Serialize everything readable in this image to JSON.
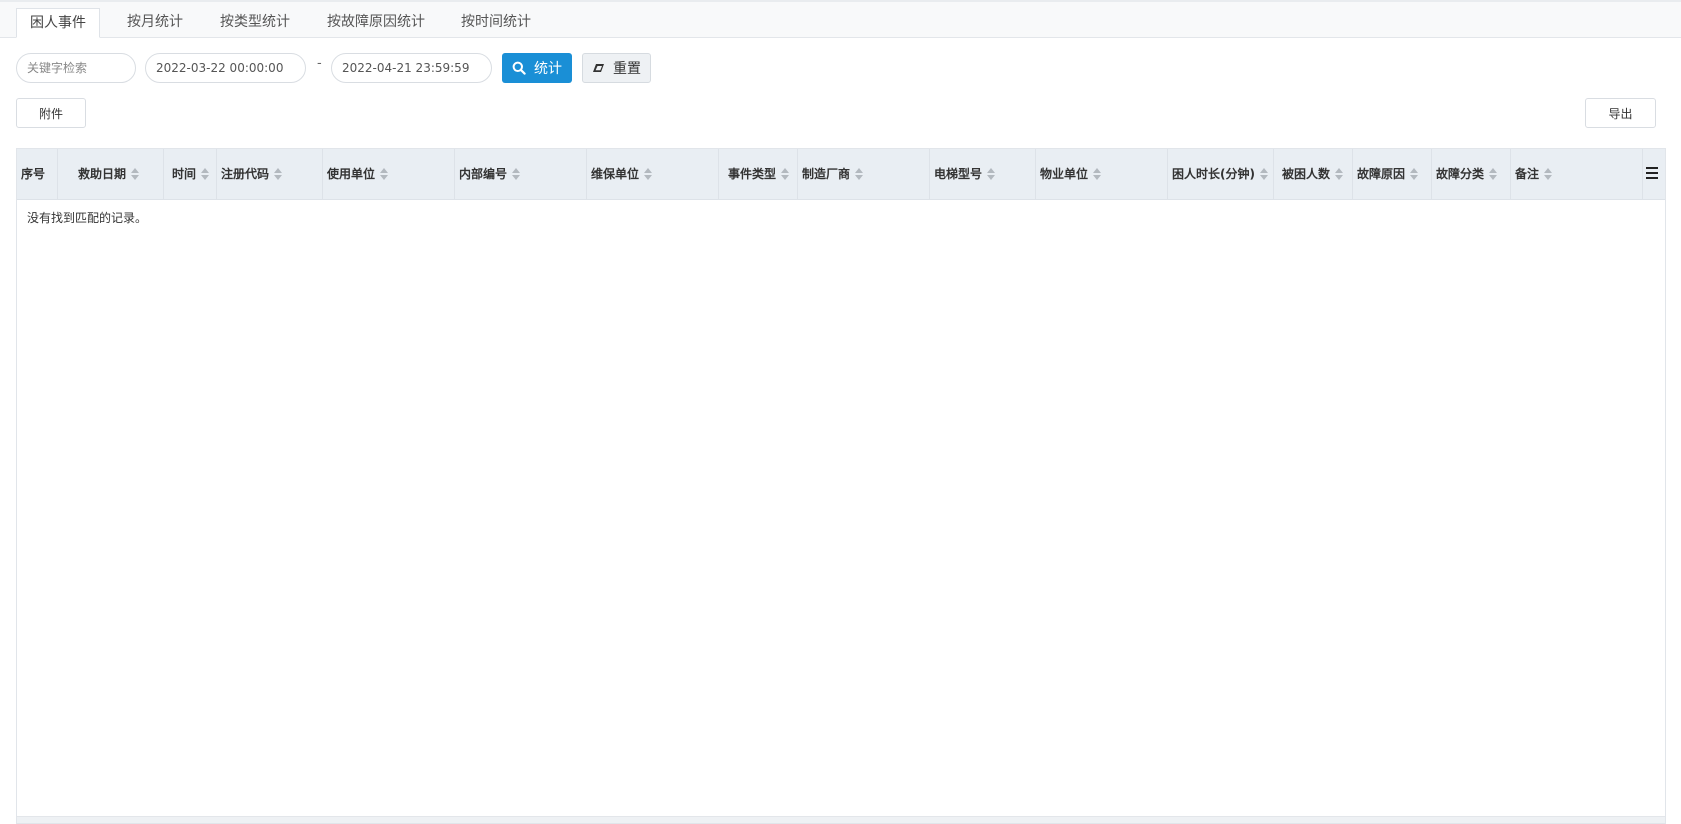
{
  "tabs": [
    {
      "label": "困人事件",
      "active": true
    },
    {
      "label": "按月统计",
      "active": false
    },
    {
      "label": "按类型统计",
      "active": false
    },
    {
      "label": "按故障原因统计",
      "active": false
    },
    {
      "label": "按时间统计",
      "active": false
    }
  ],
  "toolbar": {
    "keyword_placeholder": "关键字检索",
    "start_date": "2022-03-22 00:00:00",
    "separator": "-",
    "end_date": "2022-04-21 23:59:59",
    "stat_label": "统计",
    "reset_label": "重置",
    "attachment_label": "附件",
    "export_label": "导出"
  },
  "table": {
    "columns": [
      "序号",
      "救助日期",
      "时间",
      "注册代码",
      "使用单位",
      "内部编号",
      "维保单位",
      "事件类型",
      "制造厂商",
      "电梯型号",
      "物业单位",
      "困人时长(分钟)",
      "被困人数",
      "故障原因",
      "故障分类",
      "备注"
    ],
    "empty_message": "没有找到匹配的记录。"
  },
  "colors": {
    "accent": "#1a8fd6",
    "header_bg": "#e9eef3"
  }
}
